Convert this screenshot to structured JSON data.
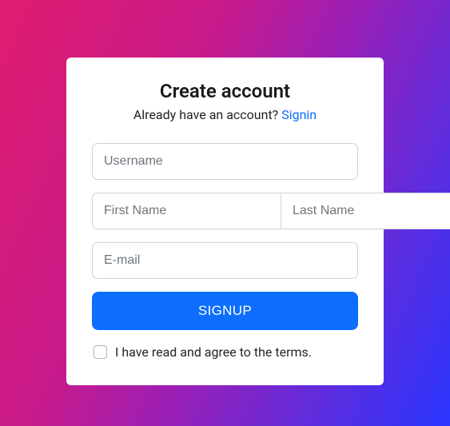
{
  "header": {
    "title": "Create account",
    "subtitle_prefix": "Already have an account? ",
    "signin_link": "Signin"
  },
  "form": {
    "username": {
      "placeholder": "Username",
      "value": ""
    },
    "first_name": {
      "placeholder": "First Name",
      "value": ""
    },
    "last_name": {
      "placeholder": "Last Name",
      "value": ""
    },
    "email": {
      "placeholder": "E-mail",
      "value": ""
    },
    "signup_button": "SIGNUP",
    "terms": {
      "checked": false,
      "label": "I have read and agree to the terms."
    }
  },
  "colors": {
    "accent": "#0d6efd",
    "gradient_start": "#e01d6f",
    "gradient_end": "#2a35ff"
  }
}
